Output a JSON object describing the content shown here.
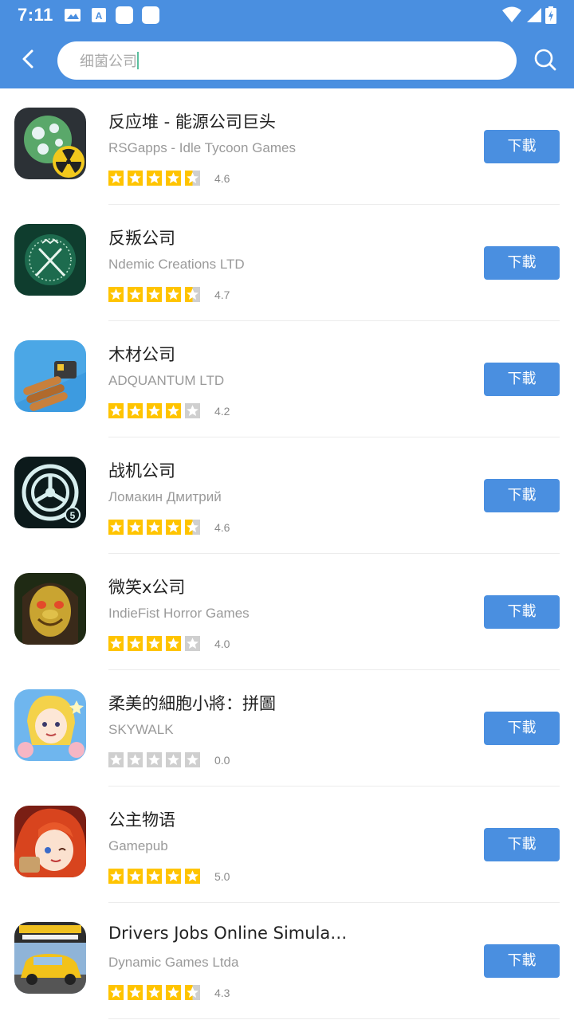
{
  "status_bar": {
    "time": "7:11"
  },
  "search": {
    "query": "细菌公司"
  },
  "colors": {
    "accent": "#4a8fe0",
    "star_filled": "#ffc400",
    "star_empty": "#cfcfcf"
  },
  "apps": [
    {
      "title": "反应堆 - 能源公司巨头",
      "developer": "RSGapps - Idle Tycoon Games",
      "rating": "4.6",
      "rating_value": 4.6,
      "download_label": "下載",
      "icon": "reactor-game-icon"
    },
    {
      "title": "反叛公司",
      "developer": "Ndemic Creations LTD",
      "rating": "4.7",
      "rating_value": 4.7,
      "download_label": "下載",
      "icon": "rebel-inc-icon"
    },
    {
      "title": "木材公司",
      "developer": "ADQUANTUM LTD",
      "rating": "4.2",
      "rating_value": 4.2,
      "download_label": "下載",
      "icon": "lumber-inc-icon"
    },
    {
      "title": "战机公司",
      "developer": "Ломакин Дмитрий",
      "rating": "4.6",
      "rating_value": 4.6,
      "download_label": "下載",
      "icon": "fan-game-icon"
    },
    {
      "title": "微笑x公司",
      "developer": "IndieFist Horror Games",
      "rating": "4.0",
      "rating_value": 4.0,
      "download_label": "下載",
      "icon": "smiling-x-icon"
    },
    {
      "title": "柔美的細胞小將：拼圖",
      "developer": "SKYWALK",
      "rating": "0.0",
      "rating_value": 0.0,
      "download_label": "下載",
      "icon": "cells-puzzle-icon"
    },
    {
      "title": "公主物语",
      "developer": "Gamepub",
      "rating": "5.0",
      "rating_value": 5.0,
      "download_label": "下載",
      "icon": "princess-tale-icon"
    },
    {
      "title": "Drivers Jobs Online Simulat…",
      "developer": "Dynamic Games Ltda",
      "rating": "4.3",
      "rating_value": 4.3,
      "download_label": "下載",
      "icon": "drivers-jobs-icon"
    }
  ]
}
